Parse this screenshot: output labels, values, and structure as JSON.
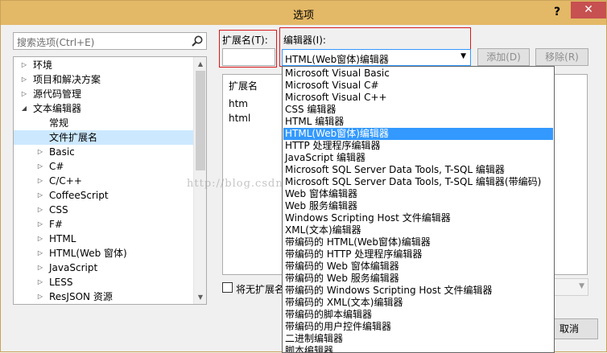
{
  "window": {
    "title": "选项",
    "help": "?",
    "close": "✕"
  },
  "search": {
    "placeholder": "搜索选项(Ctrl+E)"
  },
  "tree": {
    "items": [
      {
        "label": "环境",
        "arrow": "▷"
      },
      {
        "label": "项目和解决方案",
        "arrow": "▷"
      },
      {
        "label": "源代码管理",
        "arrow": "▷"
      },
      {
        "label": "文本编辑器",
        "arrow": "◢"
      },
      {
        "label": "常规",
        "arrow": ""
      },
      {
        "label": "文件扩展名",
        "arrow": ""
      },
      {
        "label": "Basic",
        "arrow": "▷"
      },
      {
        "label": "C#",
        "arrow": "▷"
      },
      {
        "label": "C/C++",
        "arrow": "▷"
      },
      {
        "label": "CoffeeScript",
        "arrow": "▷"
      },
      {
        "label": "CSS",
        "arrow": "▷"
      },
      {
        "label": "F#",
        "arrow": "▷"
      },
      {
        "label": "HTML",
        "arrow": "▷"
      },
      {
        "label": "HTML(Web 窗体)",
        "arrow": "▷"
      },
      {
        "label": "JavaScript",
        "arrow": "▷"
      },
      {
        "label": "LESS",
        "arrow": "▷"
      },
      {
        "label": "ResJSON 资源",
        "arrow": "▷"
      }
    ],
    "selected_index": 5
  },
  "extension": {
    "label": "扩展名(T):",
    "value": ""
  },
  "editor": {
    "label": "编辑器(I):",
    "selected": "HTML(Web窗体)编辑器",
    "options": [
      "Microsoft Visual Basic",
      "Microsoft Visual C#",
      "Microsoft Visual C++",
      "CSS 编辑器",
      "HTML 编辑器",
      "HTML(Web窗体)编辑器",
      "HTTP 处理程序编辑器",
      "JavaScript 编辑器",
      "Microsoft SQL Server Data Tools, T-SQL 编辑器",
      "Microsoft SQL Server Data Tools, T-SQL 编辑器(带编码)",
      "Web 窗体编辑器",
      "Web 服务编辑器",
      "Windows Scripting Host 文件编辑器",
      "XML(文本)编辑器",
      "带编码的 HTML(Web窗体)编辑器",
      "带编码的 HTTP 处理程序编辑器",
      "带编码的 Web 窗体编辑器",
      "带编码的 Web 服务编辑器",
      "带编码的 Windows Scripting Host 文件编辑器",
      "带编码的 XML(文本)编辑器",
      "带编码的脚本编辑器",
      "带编码的用户控件编辑器",
      "二进制编辑器",
      "脚本编辑器"
    ],
    "selected_index": 5
  },
  "buttons": {
    "add": "添加(D)",
    "remove": "移除(R)",
    "cancel": "取消"
  },
  "list": {
    "header": "扩展名",
    "rows": [
      "htm",
      "html"
    ]
  },
  "no_ext_checkbox": {
    "label": "将无扩展名"
  },
  "watermark": "http://blog.csdn.net/"
}
